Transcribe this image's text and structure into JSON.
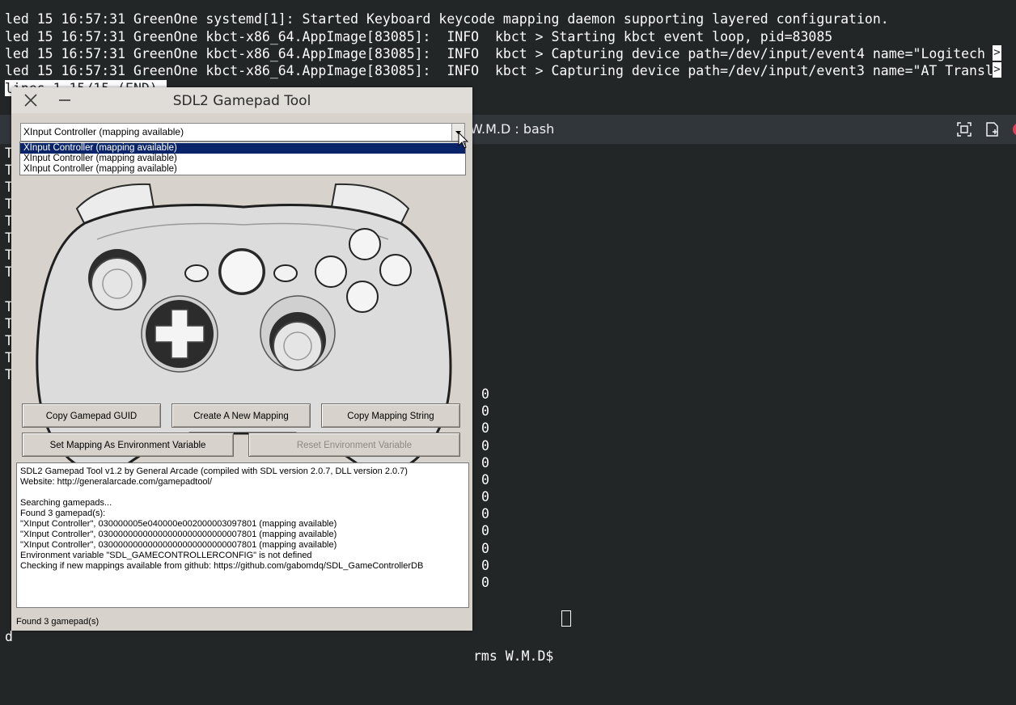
{
  "top_terminal": {
    "lines": [
      "led 15 16:57:31 GreenOne systemd[1]: Started Keyboard keycode mapping daemon supporting layered configuration.",
      "led 15 16:57:31 GreenOne kbct-x86_64.AppImage[83085]:  INFO  kbct > Starting kbct event loop, pid=83085",
      "led 15 16:57:31 GreenOne kbct-x86_64.AppImage[83085]:  INFO  kbct > Capturing device path=/dev/input/event4 name=\"Logitech ",
      "led 15 16:57:31 GreenOne kbct-x86_64.AppImage[83085]:  INFO  kbct > Capturing device path=/dev/input/event3 name=\"AT Transl"
    ],
    "truncation_marker": ">",
    "status": "lines 1-15/15 (END)"
  },
  "konsole": {
    "title": "W.M.D : bash",
    "left_chars": [
      "T",
      "T",
      "T",
      "T",
      "T",
      "T",
      "T",
      "T",
      "T",
      "T",
      "T",
      "T",
      "T",
      "T"
    ],
    "zeros": [
      "0",
      "0",
      "0",
      "0",
      "0",
      "0",
      "0",
      "0",
      "0",
      "0",
      "0",
      "0"
    ],
    "prompt_left": "d",
    "prompt_right": "rms W.M.D$ "
  },
  "sdl": {
    "title": "SDL2 Gamepad Tool",
    "controller_select": {
      "value": "XInput Controller (mapping available)",
      "options": [
        "XInput Controller (mapping available)",
        "XInput Controller (mapping available)",
        "XInput Controller (mapping available)"
      ]
    },
    "buttons": {
      "copy_guid": "Copy Gamepad GUID",
      "create_mapping": "Create A New Mapping",
      "copy_mapping": "Copy Mapping String",
      "set_env": "Set Mapping As Environment Variable",
      "reset_env": "Reset Environment Variable"
    },
    "log": [
      "SDL2 Gamepad Tool v1.2 by General Arcade (compiled with SDL version 2.0.7, DLL version 2.0.7)",
      "Website: http://generalarcade.com/gamepadtool/",
      "",
      "Searching gamepads...",
      "Found 3 gamepad(s):",
      "\"XInput Controller\", 030000005e040000e002000003097801 (mapping available)",
      "\"XInput Controller\", 03000000000000000000000000007801 (mapping available)",
      "\"XInput Controller\", 03000000000000000000000000007801 (mapping available)",
      "Environment variable \"SDL_GAMECONTROLLERCONFIG\" is not defined",
      "Checking if new mappings available from github: https://github.com/gabomdq/SDL_GameControllerDB"
    ],
    "status": "Found 3 gamepad(s)"
  }
}
